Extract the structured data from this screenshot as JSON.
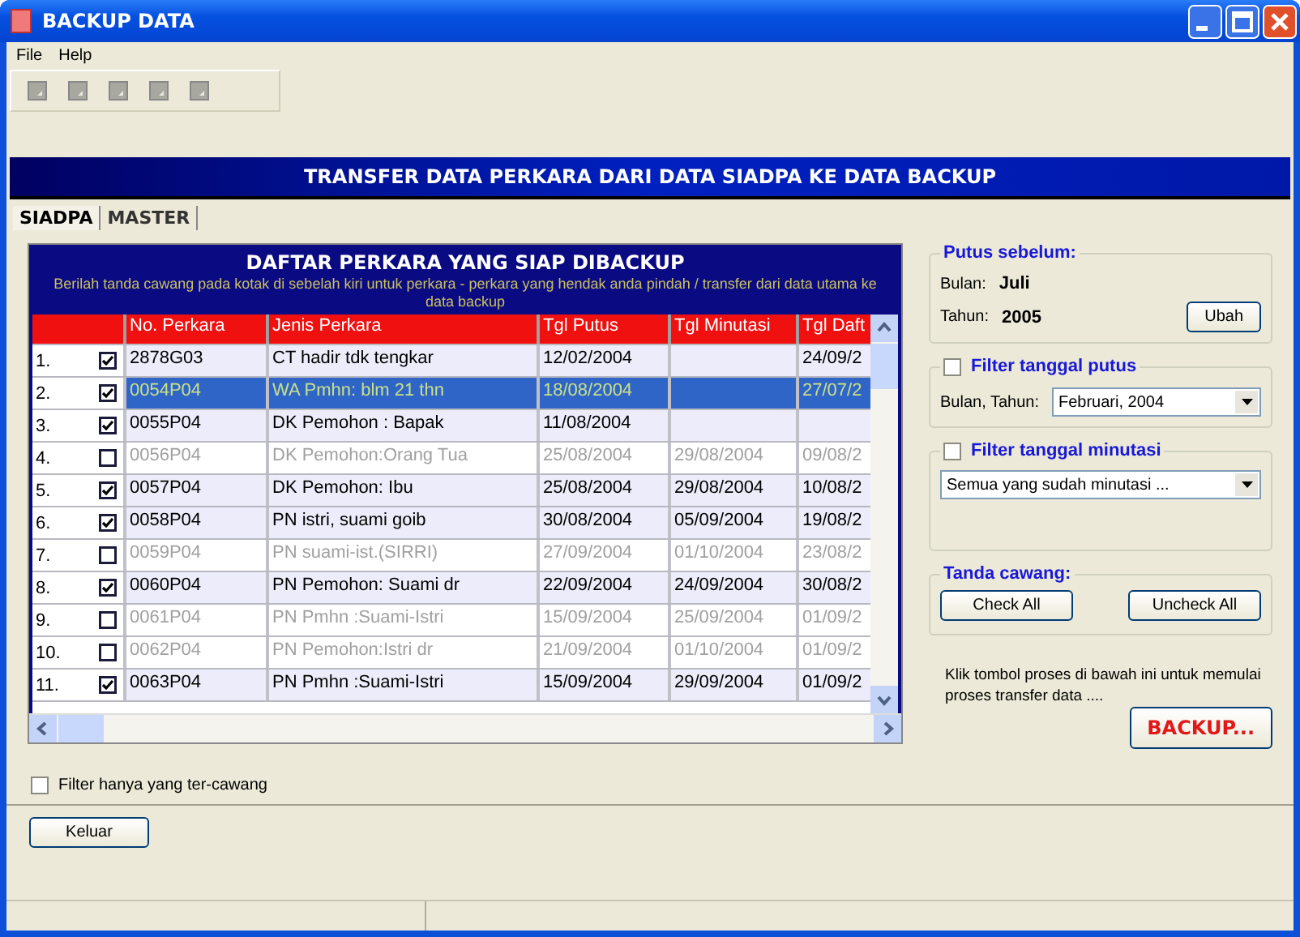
{
  "window": {
    "title": "BACKUP DATA"
  },
  "menu": [
    "File",
    "Help"
  ],
  "toolbar_buttons": [
    {
      "disabled": true
    },
    {
      "disabled": true
    },
    {
      "disabled": true
    },
    {
      "disabled": true
    },
    {
      "disabled": true
    }
  ],
  "banner": "TRANSFER DATA PERKARA DARI DATA SIADPA KE DATA BACKUP",
  "tabs": [
    {
      "label": "SIADPA",
      "selected": true
    },
    {
      "label": "MASTER",
      "selected": false
    }
  ],
  "grid": {
    "title": "DAFTAR PERKARA YANG SIAP DIBACKUP",
    "instruction": "Berilah tanda cawang pada kotak di sebelah kiri untuk perkara - perkara yang hendak anda pindah / transfer dari data utama ke data backup",
    "columns": [
      "No. Perkara",
      "Jenis Perkara",
      "Tgl Putus",
      "Tgl Minutasi",
      "Tgl Daft"
    ],
    "rows": [
      {
        "number": "1.",
        "checked": true,
        "selected": false,
        "cells": [
          "2878G03",
          "CT hadir tdk tengkar",
          "12/02/2004",
          "",
          "24/09/2"
        ]
      },
      {
        "number": "2.",
        "checked": true,
        "selected": true,
        "cells": [
          "0054P04",
          "WA Pmhn: blm 21 thn",
          "18/08/2004",
          "",
          "27/07/2"
        ]
      },
      {
        "number": "3.",
        "checked": true,
        "selected": false,
        "cells": [
          "0055P04",
          "DK Pemohon : Bapak",
          "11/08/2004",
          "",
          ""
        ]
      },
      {
        "number": "4.",
        "checked": false,
        "selected": false,
        "cells": [
          "0056P04",
          "DK Pemohon:Orang Tua",
          "25/08/2004",
          "29/08/2004",
          "09/08/2"
        ]
      },
      {
        "number": "5.",
        "checked": true,
        "selected": false,
        "cells": [
          "0057P04",
          "DK Pemohon: Ibu",
          "25/08/2004",
          "29/08/2004",
          "10/08/2"
        ]
      },
      {
        "number": "6.",
        "checked": true,
        "selected": false,
        "cells": [
          "0058P04",
          "PN istri, suami goib",
          "30/08/2004",
          "05/09/2004",
          "19/08/2"
        ]
      },
      {
        "number": "7.",
        "checked": false,
        "selected": false,
        "cells": [
          "0059P04",
          "PN suami-ist.(SIRRI)",
          "27/09/2004",
          "01/10/2004",
          "23/08/2"
        ]
      },
      {
        "number": "8.",
        "checked": true,
        "selected": false,
        "cells": [
          "0060P04",
          "PN Pemohon: Suami dr",
          "22/09/2004",
          "24/09/2004",
          "30/08/2"
        ]
      },
      {
        "number": "9.",
        "checked": false,
        "selected": false,
        "cells": [
          "0061P04",
          "PN Pmhn :Suami-Istri",
          "15/09/2004",
          "25/09/2004",
          "01/09/2"
        ]
      },
      {
        "number": "10.",
        "checked": false,
        "selected": false,
        "cells": [
          "0062P04",
          "PN Pemohon:Istri dr",
          "21/09/2004",
          "01/10/2004",
          "01/09/2"
        ]
      },
      {
        "number": "11.",
        "checked": true,
        "selected": false,
        "cells": [
          "0063P04",
          "PN Pmhn :Suami-Istri",
          "15/09/2004",
          "29/09/2004",
          "01/09/2"
        ]
      }
    ]
  },
  "filter_checked": {
    "label": "Filter hanya yang ter-cawang",
    "checked": false
  },
  "exit_button": "Keluar",
  "putus_sebelum": {
    "title": "Putus sebelum:",
    "fields": [
      {
        "label": "Bulan:",
        "value": "Juli"
      },
      {
        "label": "Tahun:",
        "value": "2005"
      }
    ],
    "button": "Ubah"
  },
  "filter_putus": {
    "label": "Filter tanggal putus",
    "checked": false,
    "field_label": "Bulan, Tahun:",
    "value": "Februari, 2004"
  },
  "filter_minutasi": {
    "label": "Filter tanggal minutasi",
    "checked": false,
    "value": "Semua yang sudah minutasi ..."
  },
  "tanda_cawang": {
    "title": "Tanda cawang:",
    "buttons": [
      "Check All",
      "Uncheck All"
    ]
  },
  "note": "Klik tombol proses di bawah ini untuk memulai proses transfer data ....",
  "backup_button": "BACKUP..."
}
